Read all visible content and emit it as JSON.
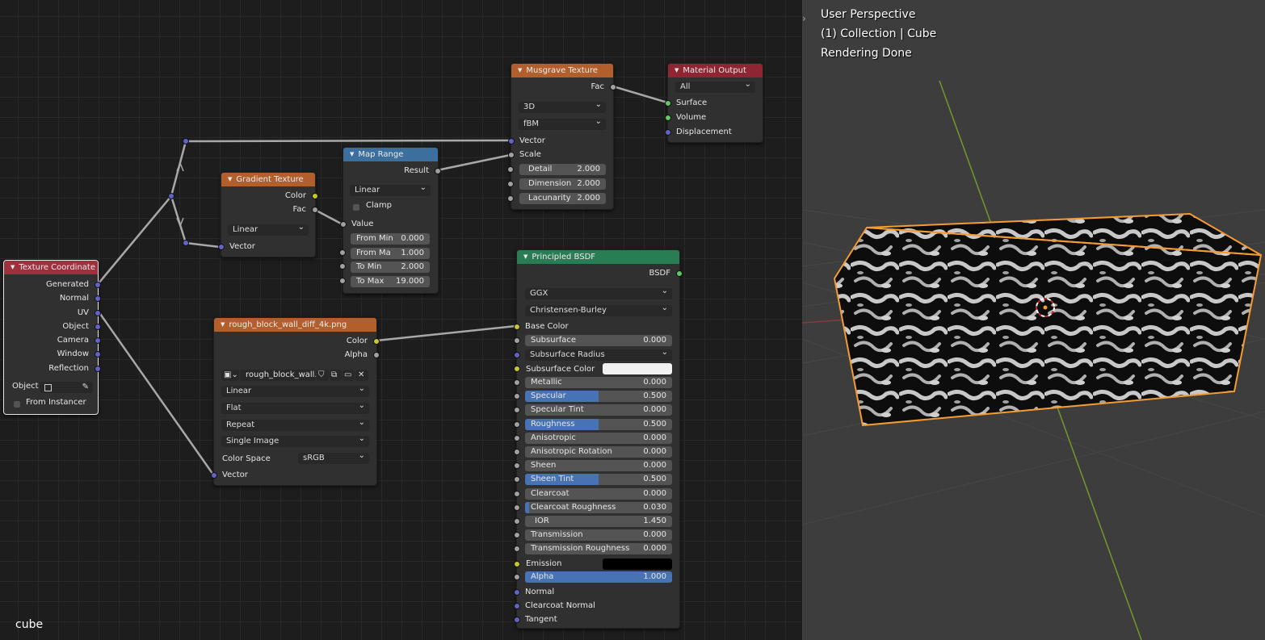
{
  "editor": {
    "footer_label": "cube",
    "nodes": {
      "texture_coordinate": {
        "title": "Texture Coordinate",
        "outputs": [
          "Generated",
          "Normal",
          "UV",
          "Object",
          "Camera",
          "Window",
          "Reflection"
        ],
        "object_label": "Object",
        "from_instancer": "From Instancer"
      },
      "gradient_texture": {
        "title": "Gradient Texture",
        "outputs": [
          "Color",
          "Fac"
        ],
        "type": "Linear",
        "input": "Vector"
      },
      "map_range": {
        "title": "Map Range",
        "output": "Result",
        "interpolation": "Linear",
        "clamp": "Clamp",
        "value_input": "Value",
        "fields": [
          {
            "label": "From Min",
            "value": "0.000"
          },
          {
            "label": "From Ma",
            "value": "1.000"
          },
          {
            "label": "To Min",
            "value": "2.000"
          },
          {
            "label": "To Max",
            "value": "19.000"
          }
        ]
      },
      "musgrave_texture": {
        "title": "Musgrave Texture",
        "output": "Fac",
        "dimensions": "3D",
        "type": "fBM",
        "inputs": [
          "Vector",
          "Scale"
        ],
        "fields": [
          {
            "label": "Detail",
            "value": "2.000"
          },
          {
            "label": "Dimension",
            "value": "2.000"
          },
          {
            "label": "Lacunarity",
            "value": "2.000"
          }
        ]
      },
      "material_output": {
        "title": "Material Output",
        "target": "All",
        "inputs": [
          "Surface",
          "Volume",
          "Displacement"
        ]
      },
      "image_texture": {
        "title": "rough_block_wall_diff_4k.png",
        "outputs": [
          "Color",
          "Alpha"
        ],
        "image_name": "rough_block_wall...",
        "interpolation": "Linear",
        "projection": "Flat",
        "extension": "Repeat",
        "source": "Single Image",
        "color_space_label": "Color Space",
        "color_space": "sRGB",
        "input": "Vector"
      },
      "principled_bsdf": {
        "title": "Principled BSDF",
        "output": "BSDF",
        "distribution": "GGX",
        "subsurface_method": "Christensen-Burley",
        "base_color": "Base Color",
        "subsurface": {
          "label": "Subsurface",
          "value": "0.000"
        },
        "subsurface_radius": "Subsurface Radius",
        "subsurface_color": "Subsurface Color",
        "fields": [
          {
            "label": "Metallic",
            "value": "0.000",
            "fill": 0
          },
          {
            "label": "Specular",
            "value": "0.500",
            "fill": 0.5
          },
          {
            "label": "Specular Tint",
            "value": "0.000",
            "fill": 0
          },
          {
            "label": "Roughness",
            "value": "0.500",
            "fill": 0.5
          },
          {
            "label": "Anisotropic",
            "value": "0.000",
            "fill": 0
          },
          {
            "label": "Anisotropic Rotation",
            "value": "0.000",
            "fill": 0
          },
          {
            "label": "Sheen",
            "value": "0.000",
            "fill": 0
          },
          {
            "label": "Sheen Tint",
            "value": "0.500",
            "fill": 0.5
          },
          {
            "label": "Clearcoat",
            "value": "0.000",
            "fill": 0
          },
          {
            "label": "Clearcoat Roughness",
            "value": "0.030",
            "fill": 0.03
          },
          {
            "label": "IOR",
            "value": "1.450",
            "fill": 0
          },
          {
            "label": "Transmission",
            "value": "0.000",
            "fill": 0
          },
          {
            "label": "Transmission Roughness",
            "value": "0.000",
            "fill": 0
          }
        ],
        "emission": "Emission",
        "alpha": {
          "label": "Alpha",
          "value": "1.000",
          "fill": 1
        },
        "vector_inputs": [
          "Normal",
          "Clearcoat Normal",
          "Tangent"
        ]
      }
    }
  },
  "viewport": {
    "lines": [
      "User Perspective",
      "(1) Collection | Cube",
      "Rendering Done"
    ]
  },
  "colors": {
    "selection_outline": "#f39c33",
    "slider_fill": "#4772b3",
    "socket_vector": "#6363c7",
    "socket_color": "#c7c729",
    "socket_float": "#a1a1a1",
    "socket_shader": "#63c763"
  }
}
